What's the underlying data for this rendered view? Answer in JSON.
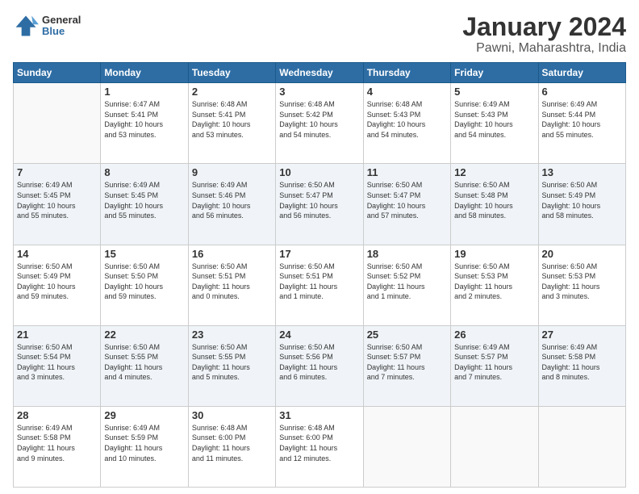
{
  "header": {
    "logo_general": "General",
    "logo_blue": "Blue",
    "title": "January 2024",
    "subtitle": "Pawni, Maharashtra, India"
  },
  "days_of_week": [
    "Sunday",
    "Monday",
    "Tuesday",
    "Wednesday",
    "Thursday",
    "Friday",
    "Saturday"
  ],
  "weeks": [
    {
      "shaded": false,
      "days": [
        {
          "num": "",
          "info": ""
        },
        {
          "num": "1",
          "info": "Sunrise: 6:47 AM\nSunset: 5:41 PM\nDaylight: 10 hours\nand 53 minutes."
        },
        {
          "num": "2",
          "info": "Sunrise: 6:48 AM\nSunset: 5:41 PM\nDaylight: 10 hours\nand 53 minutes."
        },
        {
          "num": "3",
          "info": "Sunrise: 6:48 AM\nSunset: 5:42 PM\nDaylight: 10 hours\nand 54 minutes."
        },
        {
          "num": "4",
          "info": "Sunrise: 6:48 AM\nSunset: 5:43 PM\nDaylight: 10 hours\nand 54 minutes."
        },
        {
          "num": "5",
          "info": "Sunrise: 6:49 AM\nSunset: 5:43 PM\nDaylight: 10 hours\nand 54 minutes."
        },
        {
          "num": "6",
          "info": "Sunrise: 6:49 AM\nSunset: 5:44 PM\nDaylight: 10 hours\nand 55 minutes."
        }
      ]
    },
    {
      "shaded": true,
      "days": [
        {
          "num": "7",
          "info": "Sunrise: 6:49 AM\nSunset: 5:45 PM\nDaylight: 10 hours\nand 55 minutes."
        },
        {
          "num": "8",
          "info": "Sunrise: 6:49 AM\nSunset: 5:45 PM\nDaylight: 10 hours\nand 55 minutes."
        },
        {
          "num": "9",
          "info": "Sunrise: 6:49 AM\nSunset: 5:46 PM\nDaylight: 10 hours\nand 56 minutes."
        },
        {
          "num": "10",
          "info": "Sunrise: 6:50 AM\nSunset: 5:47 PM\nDaylight: 10 hours\nand 56 minutes."
        },
        {
          "num": "11",
          "info": "Sunrise: 6:50 AM\nSunset: 5:47 PM\nDaylight: 10 hours\nand 57 minutes."
        },
        {
          "num": "12",
          "info": "Sunrise: 6:50 AM\nSunset: 5:48 PM\nDaylight: 10 hours\nand 58 minutes."
        },
        {
          "num": "13",
          "info": "Sunrise: 6:50 AM\nSunset: 5:49 PM\nDaylight: 10 hours\nand 58 minutes."
        }
      ]
    },
    {
      "shaded": false,
      "days": [
        {
          "num": "14",
          "info": "Sunrise: 6:50 AM\nSunset: 5:49 PM\nDaylight: 10 hours\nand 59 minutes."
        },
        {
          "num": "15",
          "info": "Sunrise: 6:50 AM\nSunset: 5:50 PM\nDaylight: 10 hours\nand 59 minutes."
        },
        {
          "num": "16",
          "info": "Sunrise: 6:50 AM\nSunset: 5:51 PM\nDaylight: 11 hours\nand 0 minutes."
        },
        {
          "num": "17",
          "info": "Sunrise: 6:50 AM\nSunset: 5:51 PM\nDaylight: 11 hours\nand 1 minute."
        },
        {
          "num": "18",
          "info": "Sunrise: 6:50 AM\nSunset: 5:52 PM\nDaylight: 11 hours\nand 1 minute."
        },
        {
          "num": "19",
          "info": "Sunrise: 6:50 AM\nSunset: 5:53 PM\nDaylight: 11 hours\nand 2 minutes."
        },
        {
          "num": "20",
          "info": "Sunrise: 6:50 AM\nSunset: 5:53 PM\nDaylight: 11 hours\nand 3 minutes."
        }
      ]
    },
    {
      "shaded": true,
      "days": [
        {
          "num": "21",
          "info": "Sunrise: 6:50 AM\nSunset: 5:54 PM\nDaylight: 11 hours\nand 3 minutes."
        },
        {
          "num": "22",
          "info": "Sunrise: 6:50 AM\nSunset: 5:55 PM\nDaylight: 11 hours\nand 4 minutes."
        },
        {
          "num": "23",
          "info": "Sunrise: 6:50 AM\nSunset: 5:55 PM\nDaylight: 11 hours\nand 5 minutes."
        },
        {
          "num": "24",
          "info": "Sunrise: 6:50 AM\nSunset: 5:56 PM\nDaylight: 11 hours\nand 6 minutes."
        },
        {
          "num": "25",
          "info": "Sunrise: 6:50 AM\nSunset: 5:57 PM\nDaylight: 11 hours\nand 7 minutes."
        },
        {
          "num": "26",
          "info": "Sunrise: 6:49 AM\nSunset: 5:57 PM\nDaylight: 11 hours\nand 7 minutes."
        },
        {
          "num": "27",
          "info": "Sunrise: 6:49 AM\nSunset: 5:58 PM\nDaylight: 11 hours\nand 8 minutes."
        }
      ]
    },
    {
      "shaded": false,
      "days": [
        {
          "num": "28",
          "info": "Sunrise: 6:49 AM\nSunset: 5:58 PM\nDaylight: 11 hours\nand 9 minutes."
        },
        {
          "num": "29",
          "info": "Sunrise: 6:49 AM\nSunset: 5:59 PM\nDaylight: 11 hours\nand 10 minutes."
        },
        {
          "num": "30",
          "info": "Sunrise: 6:48 AM\nSunset: 6:00 PM\nDaylight: 11 hours\nand 11 minutes."
        },
        {
          "num": "31",
          "info": "Sunrise: 6:48 AM\nSunset: 6:00 PM\nDaylight: 11 hours\nand 12 minutes."
        },
        {
          "num": "",
          "info": ""
        },
        {
          "num": "",
          "info": ""
        },
        {
          "num": "",
          "info": ""
        }
      ]
    }
  ]
}
